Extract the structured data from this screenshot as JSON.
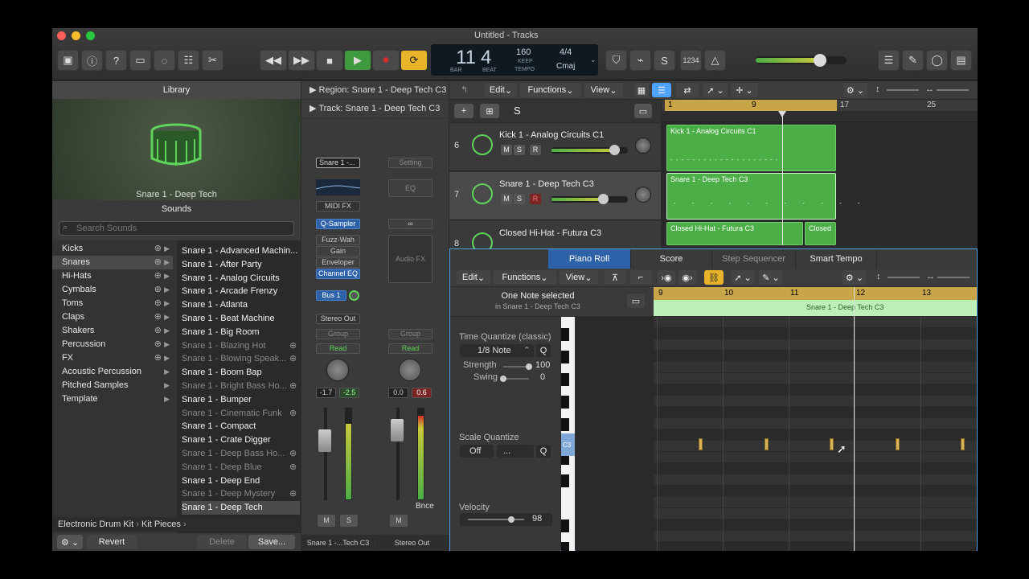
{
  "window": {
    "title": "Untitled - Tracks"
  },
  "colors": {
    "accent": "#4da3ff",
    "region_green": "#4cae47",
    "ruler_gold": "#c9a54a",
    "play_green": "#3f9a3f",
    "record_red": "#d02d2d",
    "cycle_yellow": "#e8b42a"
  },
  "toolbar": {
    "left_icons": [
      "inbox-icon",
      "info-icon",
      "help-icon",
      "editors-icon",
      "smart-controls-icon",
      "mixer-icon",
      "scissors-icon"
    ],
    "transport_icons": [
      "rewind-icon",
      "fast-forward-icon",
      "stop-icon",
      "play-icon",
      "record-icon",
      "cycle-icon"
    ],
    "right_icons": [
      "list-icon",
      "notepad-icon",
      "loops-icon",
      "browser-icon"
    ]
  },
  "lcd": {
    "bar": "11",
    "beat": "4",
    "bar_label": "BAR",
    "beat_label": "BEAT",
    "tempo": "160",
    "keep": "KEEP",
    "tempo_label": "TEMPO",
    "signature": "4/4",
    "key": "Cmaj"
  },
  "lcd_extras": {
    "count_in": "1234"
  },
  "library": {
    "header": "Library",
    "patch_name": "Snare 1 - Deep Tech",
    "sounds_header": "Sounds",
    "search_placeholder": "Search Sounds",
    "categories": [
      {
        "label": "Kicks",
        "download": true
      },
      {
        "label": "Snares",
        "download": true
      },
      {
        "label": "Hi-Hats",
        "download": true
      },
      {
        "label": "Cymbals",
        "download": true
      },
      {
        "label": "Toms",
        "download": true
      },
      {
        "label": "Claps",
        "download": true
      },
      {
        "label": "Shakers",
        "download": true
      },
      {
        "label": "Percussion",
        "download": true
      },
      {
        "label": "FX",
        "download": true
      },
      {
        "label": "Acoustic Percussion",
        "download": false
      },
      {
        "label": "Pitched Samples",
        "download": false
      },
      {
        "label": "Template",
        "download": false
      }
    ],
    "sounds": [
      {
        "label": "Snare 1 - Advanced Machin...",
        "dim": false
      },
      {
        "label": "Snare 1 - After Party",
        "dim": false
      },
      {
        "label": "Snare 1 - Analog Circuits",
        "dim": false
      },
      {
        "label": "Snare 1 - Arcade Frenzy",
        "dim": false
      },
      {
        "label": "Snare 1 - Atlanta",
        "dim": false
      },
      {
        "label": "Snare 1 - Beat Machine",
        "dim": false
      },
      {
        "label": "Snare 1 - Big Room",
        "dim": false
      },
      {
        "label": "Snare 1 - Blazing Hot",
        "dim": true
      },
      {
        "label": "Snare 1 - Blowing Speak...",
        "dim": true
      },
      {
        "label": "Snare 1 - Boom Bap",
        "dim": false
      },
      {
        "label": "Snare 1 - Bright Bass Ho...",
        "dim": true
      },
      {
        "label": "Snare 1 - Bumper",
        "dim": false
      },
      {
        "label": "Snare 1 - Cinematic Funk",
        "dim": true
      },
      {
        "label": "Snare 1 - Compact",
        "dim": false
      },
      {
        "label": "Snare 1 - Crate Digger",
        "dim": false
      },
      {
        "label": "Snare 1 - Deep Bass Ho...",
        "dim": true
      },
      {
        "label": "Snare 1 - Deep Blue",
        "dim": true
      },
      {
        "label": "Snare 1 - Deep End",
        "dim": false
      },
      {
        "label": "Snare 1 - Deep Mystery",
        "dim": true
      },
      {
        "label": "Snare 1 - Deep Tech",
        "dim": false
      }
    ],
    "breadcrumb": [
      "Electronic Drum Kit",
      "Kit Pieces"
    ],
    "revert": "Revert",
    "delete": "Delete",
    "save": "Save..."
  },
  "inspector": {
    "region_label": "Region:",
    "region_name": "Snare 1 - Deep Tech C3",
    "track_label": "Track:",
    "track_name": "Snare 1 - Deep Tech C3",
    "strip1": {
      "setting": "Snare 1 -...",
      "midi_fx": "MIDI FX",
      "instrument": "Q-Sampler",
      "fx": [
        "Fuzz-Wah",
        "Gain",
        "Enveloper",
        "Channel EQ"
      ],
      "send": "Bus 1",
      "output": "Stereo Out",
      "group": "Group",
      "automation": "Read",
      "pan_a": "-1.7",
      "pan_b": "-2.5",
      "mute": "M",
      "solo": "S",
      "name": "Snare 1 -...Tech C3"
    },
    "strip2": {
      "setting": "Setting",
      "eq": "EQ",
      "link": "∞",
      "audio_fx": "Audio FX",
      "group": "Group",
      "automation": "Read",
      "val_a": "0.0",
      "val_b": "0.6",
      "bounce": "Bnce",
      "mute": "M",
      "name": "Stereo Out"
    }
  },
  "tracks_header": {
    "edit": "Edit",
    "functions": "Functions",
    "view": "View",
    "add": "+",
    "solo": "S"
  },
  "tracks": [
    {
      "num": "6",
      "name": "Kick 1 - Analog Circuits C1",
      "m": "M",
      "s": "S",
      "r": "R",
      "volume": 0.82
    },
    {
      "num": "7",
      "name": "Snare 1 - Deep Tech C3",
      "m": "M",
      "s": "S",
      "r": "R",
      "volume": 0.68
    },
    {
      "num": "8",
      "name": "Closed Hi-Hat - Futura C3"
    }
  ],
  "ruler": {
    "marks": [
      "1",
      "9",
      "17",
      "25"
    ]
  },
  "regions": [
    "Kick 1 - Analog Circuits C1",
    "Snare 1 - Deep Tech C3",
    "Closed Hi-Hat - Futura C3",
    "Closed"
  ],
  "editor_tabs": [
    {
      "label": "Piano Roll",
      "active": true
    },
    {
      "label": "Score",
      "active": false
    },
    {
      "label": "Step Sequencer",
      "active": false
    },
    {
      "label": "Smart Tempo",
      "active": false
    }
  ],
  "piano_roll": {
    "edit": "Edit",
    "functions": "Functions",
    "view": "View",
    "selection": "One Note selected",
    "selection_sub": "in Snare 1 - Deep Tech C3",
    "time_quantize_label": "Time Quantize (classic)",
    "time_quantize_value": "1/8 Note",
    "q": "Q",
    "strength_label": "Strength",
    "strength_value": "100",
    "strength_level": 1.0,
    "swing_label": "Swing",
    "swing_value": "0",
    "swing_level": 0.0,
    "scale_quantize_label": "Scale Quantize",
    "scale_off": "Off",
    "scale_dots": "...",
    "velocity_label": "Velocity",
    "velocity_value": "98",
    "velocity_level": 0.77,
    "key_label": "C3",
    "ruler": [
      "9",
      "10",
      "11",
      "12",
      "13"
    ],
    "region_name": "Snare 1 - Deep Tech C3",
    "notes_count": 5
  }
}
